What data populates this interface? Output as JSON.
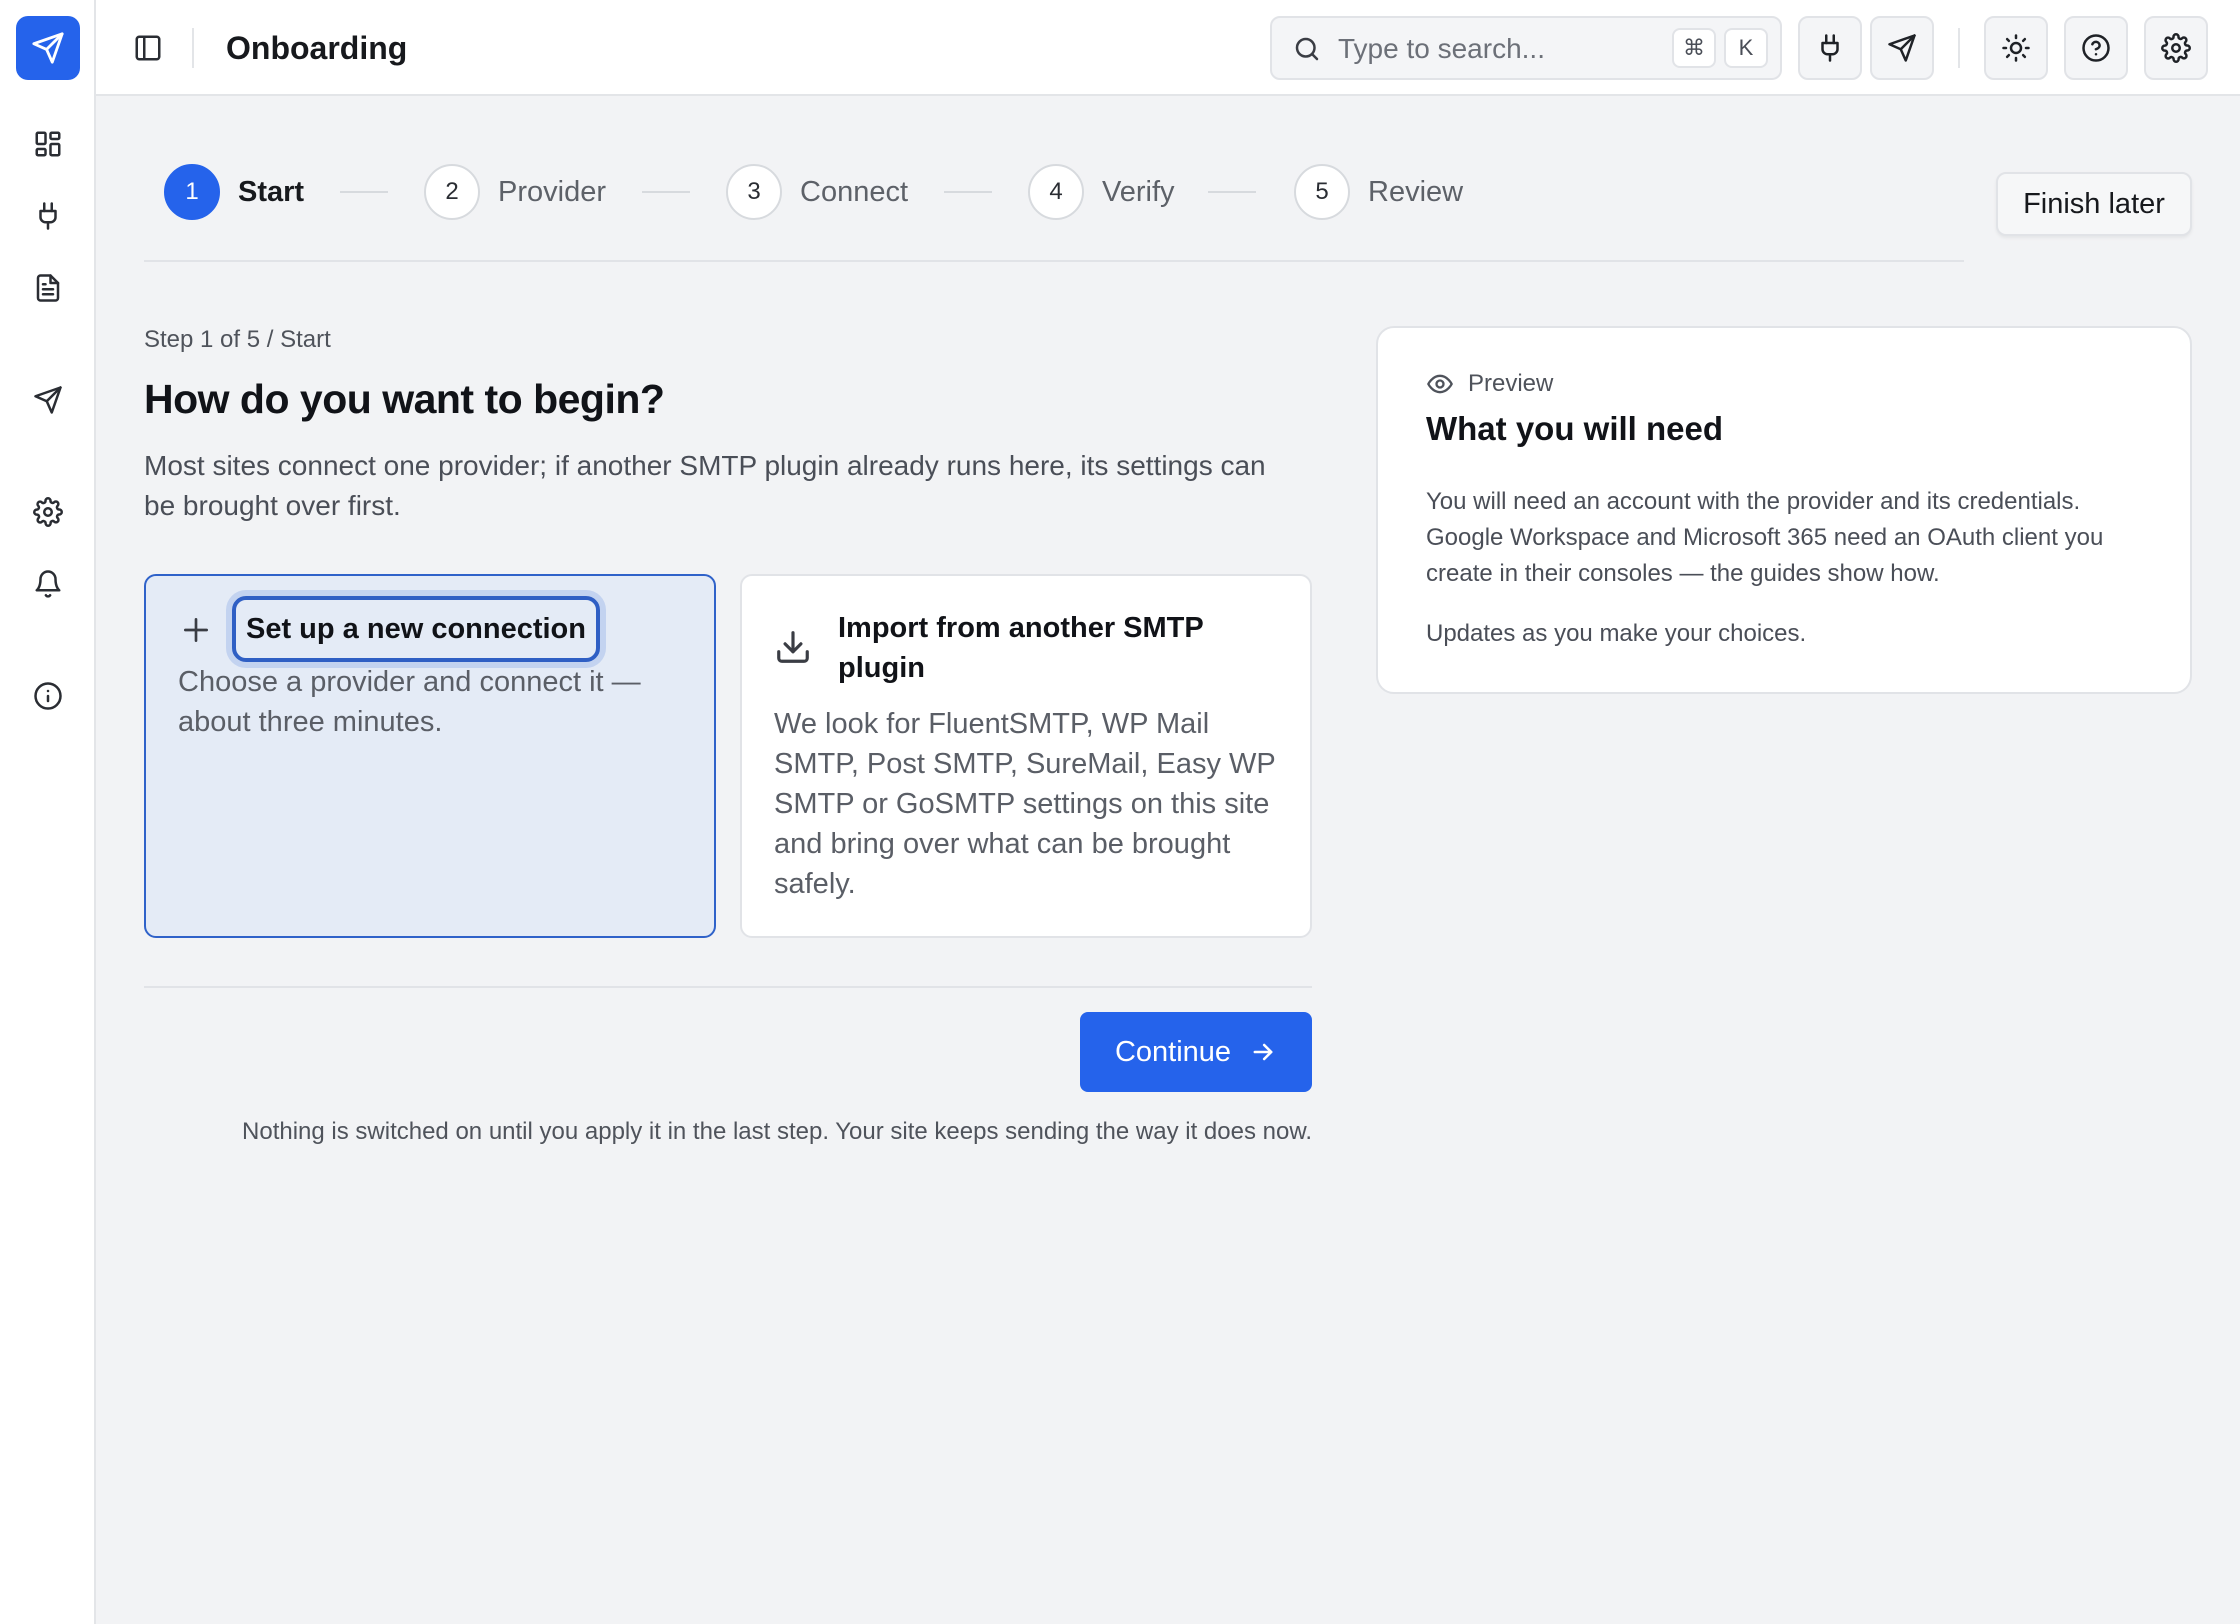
{
  "app": {
    "page_title": "Onboarding",
    "accent_color": "#2563eb"
  },
  "sidebar": {
    "logo_icon": "paper-plane-icon",
    "items": [
      {
        "name": "dashboard",
        "icon": "grid-icon"
      },
      {
        "name": "connections",
        "icon": "plug-icon"
      },
      {
        "name": "logs",
        "icon": "document-icon"
      },
      {
        "name": "send-test",
        "icon": "paper-plane-icon"
      },
      {
        "name": "settings",
        "icon": "gear-icon"
      },
      {
        "name": "notifications",
        "icon": "bell-icon"
      },
      {
        "name": "about",
        "icon": "info-icon"
      }
    ]
  },
  "topbar": {
    "search_placeholder": "Type to search...",
    "shortcut_cmd": "⌘",
    "shortcut_key": "K",
    "buttons": [
      "plug-icon",
      "paper-plane-icon",
      "sun-icon",
      "help-icon",
      "gear-icon"
    ]
  },
  "stepper": {
    "steps": [
      {
        "number": "1",
        "label": "Start",
        "active": true
      },
      {
        "number": "2",
        "label": "Provider",
        "active": false
      },
      {
        "number": "3",
        "label": "Connect",
        "active": false
      },
      {
        "number": "4",
        "label": "Verify",
        "active": false
      },
      {
        "number": "5",
        "label": "Review",
        "active": false
      }
    ],
    "finish_later_label": "Finish later"
  },
  "main": {
    "breadcrumb": "Step 1 of 5 / Start",
    "heading": "How do you want to begin?",
    "intro": "Most sites connect one provider; if another SMTP plugin already runs here, its settings can be brought over first.",
    "options": [
      {
        "icon": "plus-icon",
        "title": "Set up a new connection",
        "description": "Choose a provider and connect it — about three minutes.",
        "selected": true
      },
      {
        "icon": "download-icon",
        "title": "Import from another SMTP plugin",
        "description": "We look for FluentSMTP, WP Mail SMTP, Post SMTP, SureMail, Easy WP SMTP or GoSMTP settings on this site and bring over what can be brought safely.",
        "selected": false
      }
    ],
    "continue_label": "Continue",
    "footnote": "Nothing is switched on until you apply it in the last step. Your site keeps sending the way it does now."
  },
  "preview": {
    "kicker": "Preview",
    "title": "What you will need",
    "body": "You will need an account with the provider and its credentials. Google Workspace and Microsoft 365 need an OAuth client you create in their consoles — the guides show how.",
    "footer": "Updates as you make your choices."
  }
}
